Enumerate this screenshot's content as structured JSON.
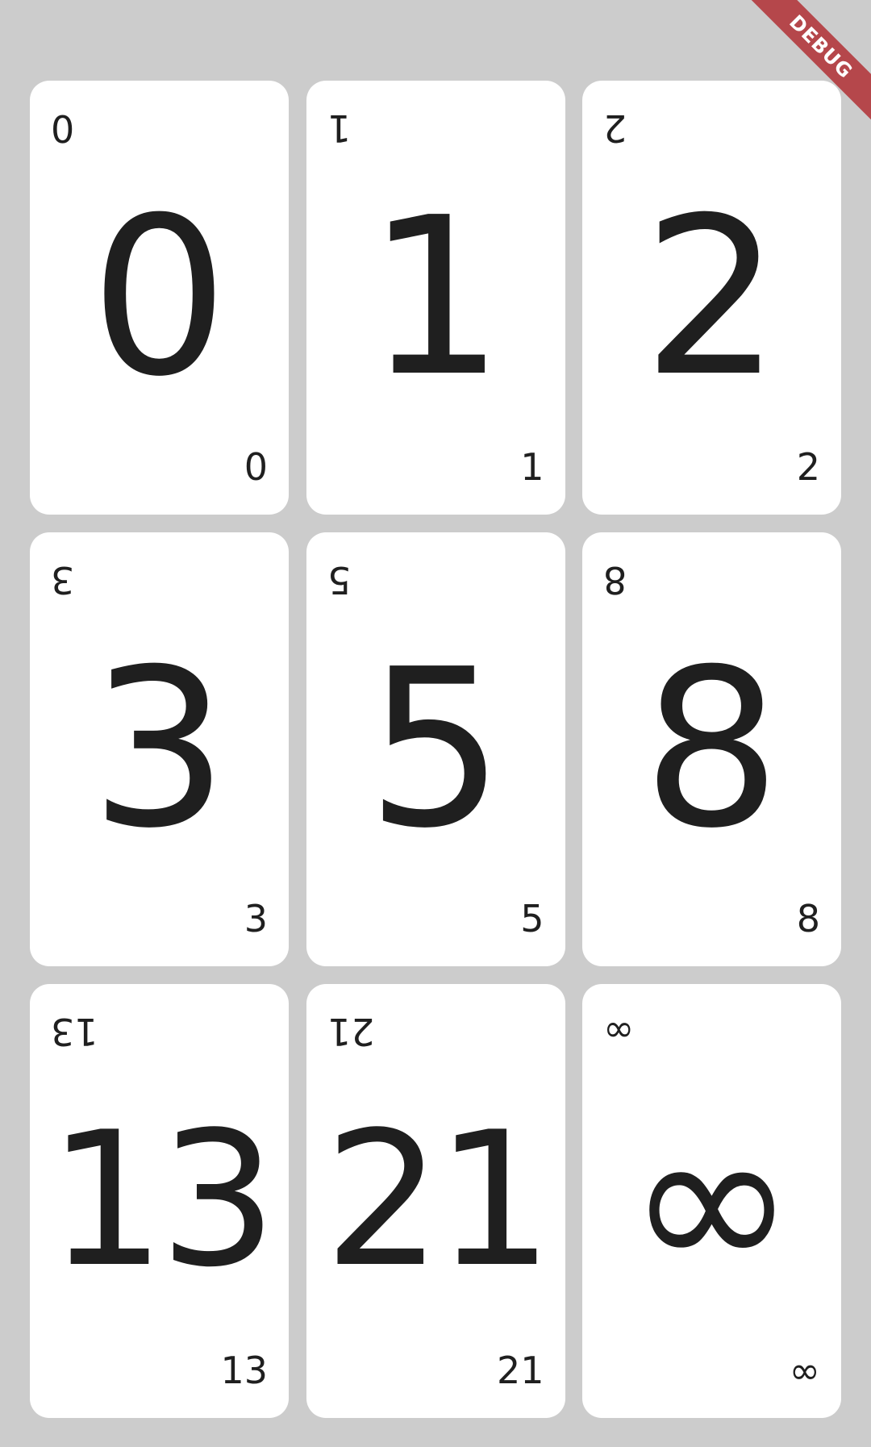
{
  "cards": [
    {
      "value": "0"
    },
    {
      "value": "1"
    },
    {
      "value": "2"
    },
    {
      "value": "3"
    },
    {
      "value": "5"
    },
    {
      "value": "8"
    },
    {
      "value": "13"
    },
    {
      "value": "21"
    },
    {
      "value": "∞"
    }
  ],
  "debug_banner": {
    "label": "DEBUG"
  },
  "colors": {
    "background": "#cccccc",
    "card": "#ffffff",
    "text": "#1f1f1f",
    "banner": "#b5474b"
  }
}
